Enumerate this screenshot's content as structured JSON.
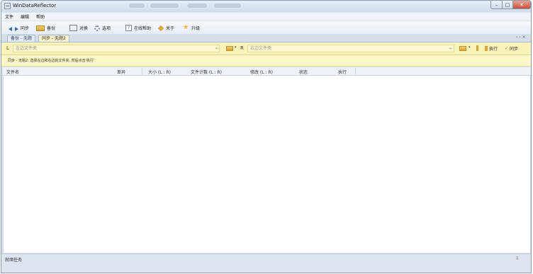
{
  "window": {
    "title": "WinDataReflector"
  },
  "menu": [
    "文件",
    "编辑",
    "帮助"
  ],
  "toolbar": {
    "sync": "同步",
    "backup": "备份",
    "compare": "对换",
    "options": "选项",
    "online_help": "在线帮助",
    "about": "关于",
    "upgrade": "升级"
  },
  "tabs": [
    "备份 - 无题",
    "同步 - 无题2"
  ],
  "tab_nav": "‹ › ×",
  "pathbar": {
    "left_letter": "L",
    "left_placeholder": "左边文件夹",
    "right_letter": "R",
    "right_placeholder": "右边文件夹",
    "execute": "执行",
    "sync": "同步"
  },
  "info": "同步 - 无题2: 选择左边和右边的文件夹, 然后点击'执行'",
  "columns": [
    "文件名",
    "差异",
    "大小 (L : R)",
    "文件计数 (L : R)",
    "修改 (L : R)",
    "状态",
    "执行"
  ],
  "status": {
    "text": "就绪任务",
    "grip": "⠿"
  },
  "icons": {
    "sync": "sync-arrows-icon",
    "backup": "backup-box-icon",
    "compare": "compare-icon",
    "options": "gear-icon",
    "help": "help-book-icon",
    "about": "about-icon",
    "upgrade": "star-icon"
  }
}
